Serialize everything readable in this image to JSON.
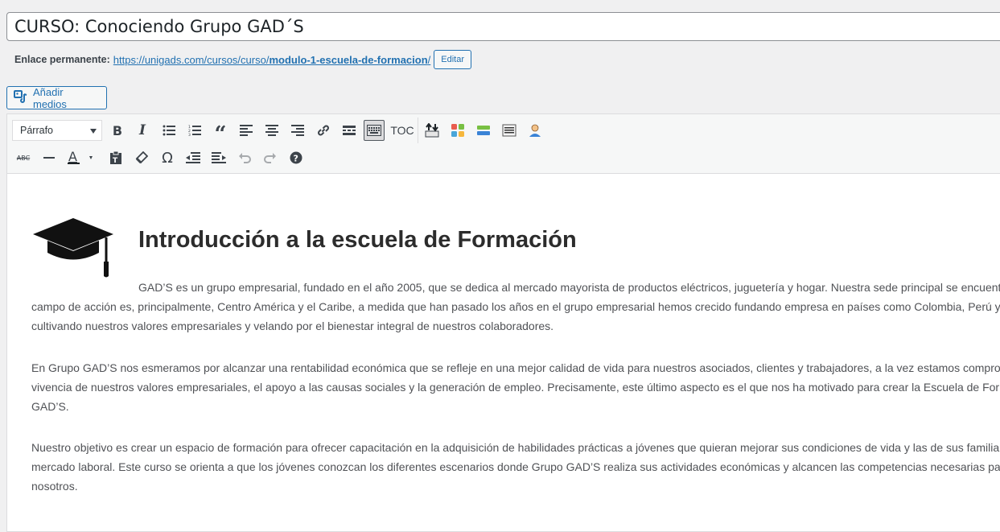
{
  "title": "CURSO: Conociendo Grupo GAD´S",
  "permalink": {
    "label": "Enlace permanente:",
    "url_prefix": "https://unigads.com/cursos/curso/",
    "url_slug": "modulo-1-escuela-de-formacion",
    "url_suffix": "/",
    "edit_label": "Editar"
  },
  "media_button": {
    "label": "Añadir medios"
  },
  "toolbar": {
    "format_selected": "Párrafo",
    "toc_label": "TOC",
    "text_color": "#1d2327",
    "row1_icons": [
      "bold-icon",
      "italic-icon",
      "bullet-list-icon",
      "numbered-list-icon",
      "blockquote-icon",
      "align-left-icon",
      "align-center-icon",
      "align-right-icon",
      "link-icon",
      "read-more-icon",
      "toolbar-toggle-icon"
    ],
    "row2_icons": [
      "strikethrough-icon",
      "horizontal-line-icon",
      "text-color-icon",
      "paste-text-icon",
      "clear-formatting-icon",
      "special-character-icon",
      "outdent-icon",
      "indent-icon",
      "undo-icon",
      "redo-icon",
      "help-icon"
    ]
  },
  "content": {
    "heading": "Introducción a la escuela de Formación",
    "paragraphs": [
      {
        "lines": [
          "GAD’S es un grupo empresarial, fundado en el año 2005, que se dedica al mercado mayorista de productos eléctricos, juguetería y hogar. Nuestra sede principal se encuent",
          "campo de acción es, principalmente, Centro América y el Caribe, a medida que han pasado los años en el grupo empresarial hemos crecido fundando empresa en países como Colombia, Perú y",
          "cultivando nuestros valores empresariales y velando por el bienestar integral de nuestros colaboradores."
        ]
      },
      {
        "lines": [
          "En Grupo GAD’S nos esmeramos por alcanzar una rentabilidad económica que se refleje en una mejor calidad de vida para nuestros asociados, clientes y trabajadores, a la vez estamos compro",
          "vivencia de nuestros valores empresariales, el apoyo a las causas sociales y la generación de empleo. Precisamente, este último aspecto es el que nos ha motivado para crear la Escuela de For",
          "GAD’S."
        ]
      },
      {
        "lines": [
          "Nuestro objetivo es crear un espacio de formación para ofrecer capacitación en la adquisición de habilidades prácticas a jóvenes que quieran mejorar sus condiciones de vida y las de sus familia",
          "mercado laboral. Este curso se orienta a que los jóvenes conozcan los diferentes escenarios donde Grupo GAD’S realiza sus actividades económicas y alcancen las competencias necesarias pa",
          "nosotros."
        ]
      }
    ]
  },
  "colors": {
    "link": "#2271b1",
    "heading": "#2c2c2c",
    "body_text": "#505256"
  }
}
